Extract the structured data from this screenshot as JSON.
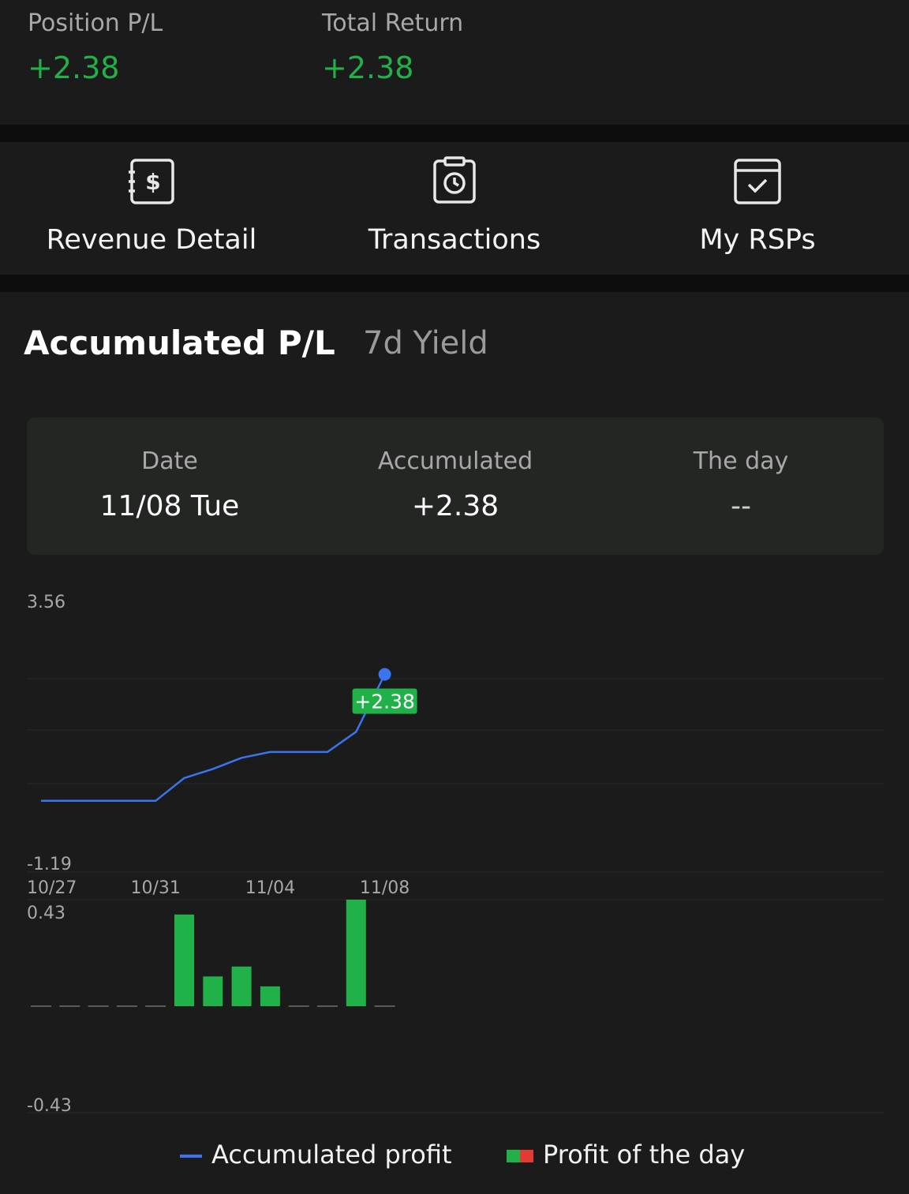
{
  "summary": {
    "position_pl": {
      "label": "Position P/L",
      "value": "+2.38"
    },
    "total_return": {
      "label": "Total Return",
      "value": "+2.38"
    }
  },
  "actions": [
    {
      "label": "Revenue Detail",
      "icon": "revenue-detail-icon"
    },
    {
      "label": "Transactions",
      "icon": "transactions-clock-icon"
    },
    {
      "label": "My RSPs",
      "icon": "calendar-check-icon"
    }
  ],
  "tabs": {
    "active": "Accumulated P/L",
    "inactive": "7d Yield"
  },
  "info_card": {
    "date_label": "Date",
    "date_value": "11/08 Tue",
    "accumulated_label": "Accumulated",
    "accumulated_value": "+2.38",
    "day_label": "The day",
    "day_value": "--"
  },
  "colors": {
    "positive": "#20b149",
    "line": "#3b74f0",
    "negative": "#e53935",
    "background": "#1b1b1b"
  },
  "chart_data": [
    {
      "type": "line",
      "ylim": [
        -1.19,
        3.56
      ],
      "y_tick_labels": [
        "3.56",
        "-1.19"
      ],
      "x_tick_labels": [
        "10/27",
        "10/31",
        "11/04",
        "11/08"
      ],
      "x": [
        "10/27",
        "10/28",
        "10/29",
        "10/30",
        "10/31",
        "11/01",
        "11/02",
        "11/03",
        "11/04",
        "11/05",
        "11/06",
        "11/07",
        "11/08"
      ],
      "series": [
        {
          "name": "Accumulated profit",
          "values": [
            0,
            0,
            0,
            0,
            0,
            0.43,
            0.6,
            0.81,
            0.92,
            0.92,
            0.92,
            1.3,
            2.38
          ]
        }
      ],
      "highlight": {
        "index": 12,
        "label": "+2.38"
      }
    },
    {
      "type": "bar",
      "ylim": [
        -0.43,
        0.43
      ],
      "y_tick_labels": [
        "0.43",
        "-0.43"
      ],
      "series": [
        {
          "name": "Profit of the day",
          "values": [
            0,
            0,
            0,
            0,
            0,
            0.37,
            0.12,
            0.16,
            0.08,
            0,
            0,
            0.43,
            0
          ]
        }
      ]
    }
  ],
  "legend": {
    "line_label": "Accumulated profit",
    "bar_label": "Profit of the day"
  }
}
